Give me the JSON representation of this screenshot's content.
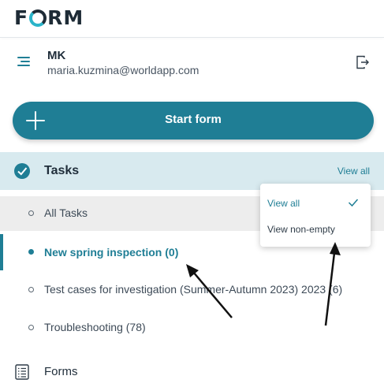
{
  "app": {
    "logo_left": "F",
    "logo_right": "RM",
    "logo_text": "FORM"
  },
  "user": {
    "name": "MK",
    "email": "maria.kuzmina@worldapp.com"
  },
  "actions": {
    "start_form_label": "Start form"
  },
  "tasks": {
    "header_label": "Tasks",
    "view_filter_label": "View all",
    "items": [
      {
        "label": "All Tasks"
      },
      {
        "label": "New spring inspection (0)",
        "active": true
      },
      {
        "label": "Test cases for investigation (Summer-Autumn 2023) 2023 (6)"
      },
      {
        "label": "Troubleshooting (78)"
      }
    ]
  },
  "view_menu": {
    "options": [
      {
        "label": "View all",
        "selected": true
      },
      {
        "label": "View non-empty",
        "selected": false
      }
    ]
  },
  "nav": {
    "forms_label": "Forms"
  },
  "colors": {
    "accent": "#1f7e95",
    "tasks_header_bg": "#d8eaef",
    "selected_row_bg": "#ededed"
  },
  "icons": [
    "hamburger-menu-icon",
    "logout-icon",
    "plus-icon",
    "tasks-check-icon",
    "checkmark-icon",
    "forms-list-icon"
  ]
}
